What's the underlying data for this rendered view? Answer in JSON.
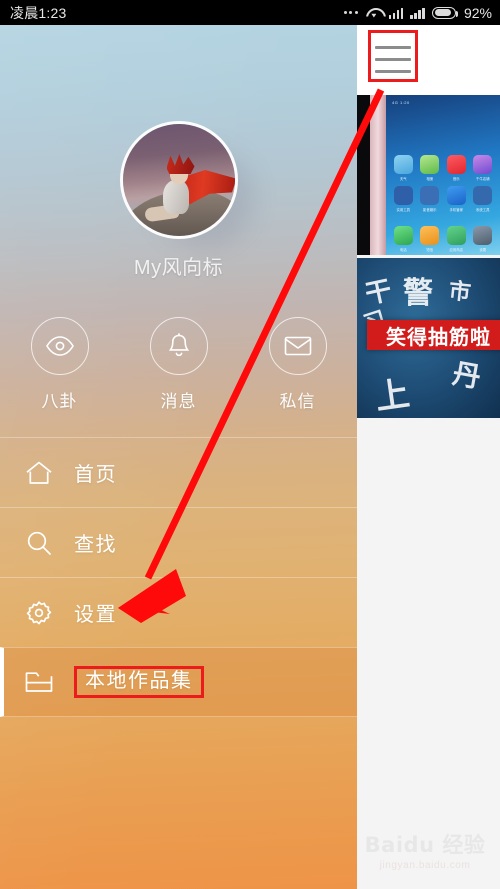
{
  "status_bar": {
    "time": "凌晨1:23",
    "battery_percent": "92%",
    "icons": [
      "more-dots",
      "wifi",
      "signal-1",
      "signal-2",
      "battery"
    ]
  },
  "drawer": {
    "profile": {
      "username": "My风向标",
      "avatar_alt": "avatar-illustration"
    },
    "quick_actions": [
      {
        "label": "八卦",
        "icon": "eye-icon"
      },
      {
        "label": "消息",
        "icon": "bell-icon"
      },
      {
        "label": "私信",
        "icon": "envelope-icon"
      }
    ],
    "menu_items": [
      {
        "label": "首页",
        "icon": "home-icon",
        "selected": false,
        "highlighted": false
      },
      {
        "label": "查找",
        "icon": "search-icon",
        "selected": false,
        "highlighted": false
      },
      {
        "label": "设置",
        "icon": "gear-icon",
        "selected": false,
        "highlighted": false
      },
      {
        "label": "本地作品集",
        "icon": "folder-icon",
        "selected": true,
        "highlighted": true
      }
    ]
  },
  "content_panel": {
    "menu_button": {
      "icon": "hamburger-icon",
      "highlighted": true
    },
    "thumbnails": [
      {
        "name": "phone-home-screen-photo",
        "status_text": "4G 1:20",
        "app_rows": [
          [
            {
              "label": "天气",
              "color": "#7fc4e8"
            },
            {
              "label": "相册",
              "color": "#8fd16a"
            },
            {
              "label": "音乐",
              "color": "#f04850"
            },
            {
              "label": "千牛店铺",
              "color": "#b272d8"
            }
          ],
          [
            {
              "label": "实用工具",
              "color": "#2f5fa8"
            },
            {
              "label": "影音娱乐",
              "color": "#3a6fb5"
            },
            {
              "label": "手机管家",
              "color": "#2a72c9"
            },
            {
              "label": "系统工具",
              "color": "#3569ad"
            }
          ],
          [
            {
              "label": "电话",
              "color": "#4cc764"
            },
            {
              "label": "短信",
              "color": "#f5a623"
            },
            {
              "label": "应用商店",
              "color": "#4ab36c"
            },
            {
              "label": "设置",
              "color": "#6b7b8c"
            }
          ]
        ]
      },
      {
        "name": "blackboard-chalk-photo",
        "chalk_text": [
          "干",
          "警",
          "市",
          "习",
          "丹",
          "上"
        ],
        "banner_text": "笑得抽筋啦",
        "banner_color": "#d21b1b"
      }
    ]
  },
  "annotations": {
    "arrow_color": "#ff0a0a",
    "box_color": "#ec1c1c"
  },
  "watermark": {
    "title": "Baidu 经验",
    "url": "jingyan.baidu.com"
  }
}
